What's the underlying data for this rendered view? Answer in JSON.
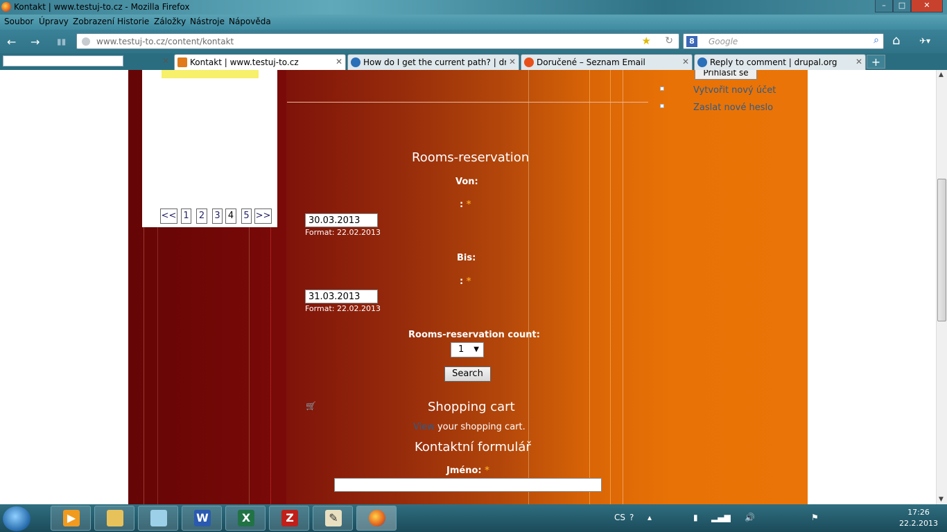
{
  "window": {
    "title": "Kontakt | www.testuj-to.cz - Mozilla Firefox",
    "minimize": "–",
    "maximize": "□",
    "close": "✕"
  },
  "menu": [
    "Soubor",
    "Úpravy",
    "Zobrazení",
    "Historie",
    "Záložky",
    "Nástroje",
    "Nápověda"
  ],
  "nav": {
    "back": "←",
    "forward": "→",
    "url": "www.testuj-to.cz/content/kontakt",
    "search_placeholder": "Google",
    "search_engine": "8",
    "home": "⌂"
  },
  "tabs": [
    {
      "label": "Kontakt | www.testuj-to.cz",
      "icon": "testuj-icon",
      "color": "#e07a1a"
    },
    {
      "label": "How do I get the current path? | drup...",
      "icon": "drupal-icon",
      "color": "#2a6fb8"
    },
    {
      "label": "Doručené – Seznam Email",
      "icon": "seznam-icon",
      "color": "#e8501a"
    },
    {
      "label": "Reply to comment | drupal.org",
      "icon": "drupal-icon",
      "color": "#2a6fb8"
    }
  ],
  "pager": [
    "<<",
    "1",
    "2",
    "3",
    "4",
    "5",
    ">>"
  ],
  "sidebar": {
    "login_button": "Přihlásit se",
    "create_account": "Vytvořit nový účet",
    "new_password": "Zaslat nové heslo"
  },
  "reservation": {
    "title": "Rooms-reservation",
    "from_label": "Von:",
    "colon": ":",
    "required": "*",
    "from_value": "30.03.2013",
    "format_text": "Format: 22.02.2013",
    "to_label": "Bis:",
    "to_value": "31.03.2013",
    "count_label": "Rooms-reservation count:",
    "count_value": "1",
    "search_button": "Search"
  },
  "cart": {
    "title": "Shopping cart",
    "view_link": "View",
    "view_text": " your shopping cart."
  },
  "contact": {
    "title": "Kontaktní formulář",
    "name_label": "Jméno:"
  },
  "taskbar": {
    "lang": "CS",
    "time": "17:26",
    "date": "22.2.2013"
  },
  "colors": {
    "accent_orange": "#ea7407",
    "dark_red": "#6e0a08",
    "link": "#2d5c8a"
  }
}
